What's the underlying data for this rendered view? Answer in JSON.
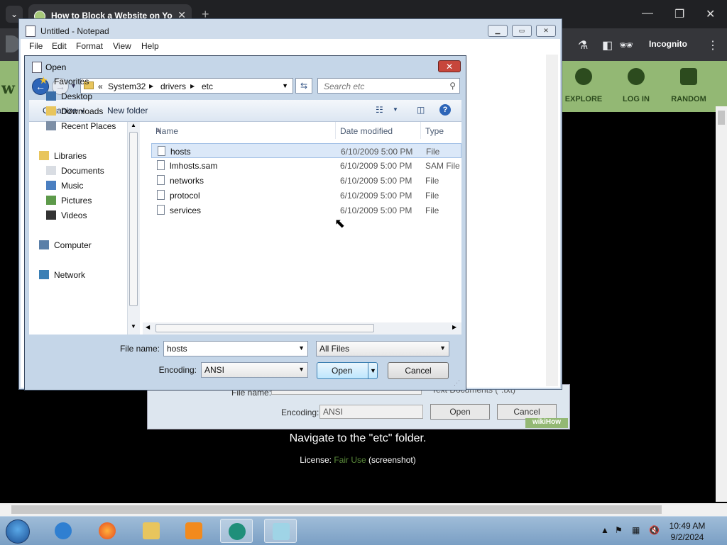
{
  "browser": {
    "tab_title": "How to Block a Website on Yo",
    "incognito_label": "Incognito"
  },
  "site": {
    "logo_letter": "w",
    "nav": [
      {
        "label": "EXPLORE"
      },
      {
        "label": "LOG IN"
      },
      {
        "label": "RANDOM"
      }
    ],
    "caption": "Navigate to the \"etc\" folder.",
    "license_prefix": "License: ",
    "license_link": "Fair Use",
    "license_suffix": " (screenshot)",
    "watermark": "wikiHow"
  },
  "bg_dialog": {
    "file_name_label": "File name:",
    "file_type_value": "Text Documents (*.txt)",
    "encoding_label": "Encoding:",
    "encoding_value": "ANSI",
    "open_label": "Open",
    "cancel_label": "Cancel"
  },
  "notepad": {
    "title": "Untitled - Notepad",
    "menu": [
      "File",
      "Edit",
      "Format",
      "View",
      "Help"
    ]
  },
  "open_dialog": {
    "title": "Open",
    "breadcrumb_prefix": "«",
    "breadcrumb": [
      "System32",
      "drivers",
      "etc"
    ],
    "search_placeholder": "Search etc",
    "organize_label": "Organize",
    "new_folder_label": "New folder",
    "nav_pane": [
      {
        "label": "Favorites",
        "icon": "star-icon",
        "indent": 0
      },
      {
        "label": "Desktop",
        "icon": "desktop-icon",
        "indent": 1
      },
      {
        "label": "Downloads",
        "icon": "downloads-icon",
        "indent": 1
      },
      {
        "label": "Recent Places",
        "icon": "recent-places-icon",
        "indent": 1
      },
      {
        "label": "Libraries",
        "icon": "libraries-icon",
        "indent": 0
      },
      {
        "label": "Documents",
        "icon": "documents-icon",
        "indent": 1
      },
      {
        "label": "Music",
        "icon": "music-icon",
        "indent": 1
      },
      {
        "label": "Pictures",
        "icon": "pictures-icon",
        "indent": 1
      },
      {
        "label": "Videos",
        "icon": "videos-icon",
        "indent": 1
      },
      {
        "label": "Computer",
        "icon": "computer-icon",
        "indent": 0
      },
      {
        "label": "Network",
        "icon": "network-icon",
        "indent": 0
      }
    ],
    "columns": [
      "Name",
      "Date modified",
      "Type"
    ],
    "files": [
      {
        "name": "hosts",
        "date": "6/10/2009 5:00 PM",
        "type": "File",
        "selected": true
      },
      {
        "name": "lmhosts.sam",
        "date": "6/10/2009 5:00 PM",
        "type": "SAM File",
        "selected": false
      },
      {
        "name": "networks",
        "date": "6/10/2009 5:00 PM",
        "type": "File",
        "selected": false
      },
      {
        "name": "protocol",
        "date": "6/10/2009 5:00 PM",
        "type": "File",
        "selected": false
      },
      {
        "name": "services",
        "date": "6/10/2009 5:00 PM",
        "type": "File",
        "selected": false
      }
    ],
    "file_name_label": "File name:",
    "file_name_value": "hosts",
    "file_type_value": "All Files",
    "encoding_label": "Encoding:",
    "encoding_value": "ANSI",
    "open_label": "Open",
    "cancel_label": "Cancel"
  },
  "taskbar": {
    "time": "10:49 AM",
    "date": "9/2/2024"
  },
  "colors": {
    "wikihow_green": "#93b874",
    "selection": "#dbe8f8",
    "dialog_frame": "#c5d6e8"
  }
}
